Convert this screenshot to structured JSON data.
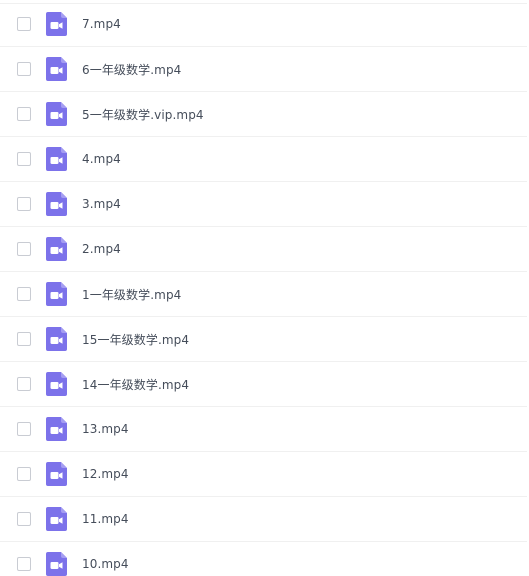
{
  "files": [
    {
      "name": "7.mp4",
      "icon": "video-file-icon"
    },
    {
      "name": "6一年级数学.mp4",
      "icon": "video-file-icon"
    },
    {
      "name": "5一年级数学.vip.mp4",
      "icon": "video-file-icon"
    },
    {
      "name": "4.mp4",
      "icon": "video-file-icon"
    },
    {
      "name": "3.mp4",
      "icon": "video-file-icon"
    },
    {
      "name": "2.mp4",
      "icon": "video-file-icon"
    },
    {
      "name": "1一年级数学.mp4",
      "icon": "video-file-icon"
    },
    {
      "name": "15一年级数学.mp4",
      "icon": "video-file-icon"
    },
    {
      "name": "14一年级数学.mp4",
      "icon": "video-file-icon"
    },
    {
      "name": "13.mp4",
      "icon": "video-file-icon"
    },
    {
      "name": "12.mp4",
      "icon": "video-file-icon"
    },
    {
      "name": "11.mp4",
      "icon": "video-file-icon"
    },
    {
      "name": "10.mp4",
      "icon": "video-file-icon"
    }
  ],
  "colors": {
    "icon_bg": "#7c72ea",
    "icon_fold": "#a59ef2",
    "text": "#454d5a",
    "divider": "#f0f0f0",
    "checkbox_border": "#c9ccd3"
  }
}
